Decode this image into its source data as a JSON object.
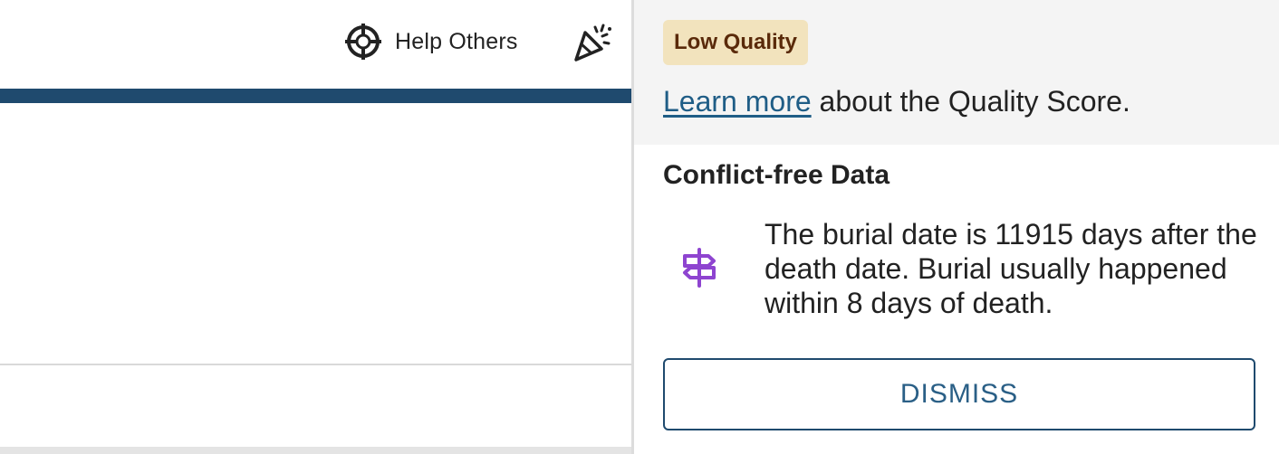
{
  "toolbar": {
    "help_others": {
      "label": "Help Others",
      "icon": "crosshair-icon"
    },
    "celebrate": {
      "icon": "party-popper-icon"
    }
  },
  "quality_panel": {
    "badge": "Low Quality",
    "learn_more": {
      "link_text": "Learn more",
      "suffix": " about the Quality Score."
    },
    "section_title": "Conflict-free Data",
    "issue": {
      "icon": "signpost-icon",
      "text": "The burial date is 11915 days after the death date. Burial usually happened within 8 days of death."
    },
    "dismiss_label": "DISMISS"
  },
  "colors": {
    "navy_bar": "#1f4a6e",
    "badge_bg": "#f2e3bd",
    "badge_text": "#5a2a0a",
    "link": "#1f5d86",
    "signpost_icon": "#8e44d0",
    "panel_header_bg": "#f4f4f4"
  }
}
